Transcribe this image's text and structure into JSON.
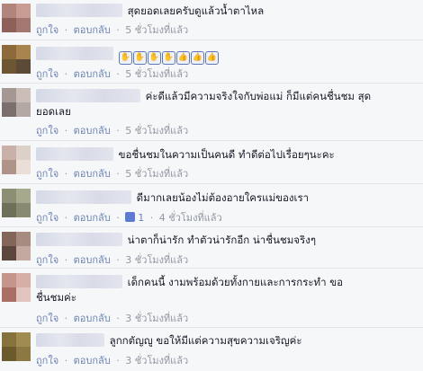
{
  "actions": {
    "like": "ถูกใจ",
    "reply": "ตอบกลับ",
    "sep": "·"
  },
  "comments": [
    {
      "text": [
        "สุดยอดเลยครับดูแล้วน้ำตาไหล"
      ],
      "time": "5 ชั่วโมงที่แล้ว"
    },
    {
      "text": [
        ""
      ],
      "time": "5 ชั่วโมงที่แล้ว",
      "icons": [
        "clapping-hands-icon",
        "thumbs-up-icon"
      ]
    },
    {
      "text": [
        "ค่ะดีแล้วมีความจริงใจกับพ่อแม่ ก็มีแต่คนชื่นชม สุด",
        "ยอดเลย"
      ],
      "time": "5 ชั่วโมงที่แล้ว"
    },
    {
      "text": [
        "ขอชื่นชมในความเป็นคนดี ทำดีต่อไปเรื่อยๆนะคะ"
      ],
      "time": "5 ชั่วโมงที่แล้ว"
    },
    {
      "text": [
        "ดีมากเลยน้องไม่ต้องอายใครแม่ของเรา"
      ],
      "time": "4 ชั่วโมงที่แล้ว",
      "likes": "1"
    },
    {
      "text": [
        "น่าตาก็น่ารัก ทำตัวน่ารักอีก น่าชื่นชมจริงๆ"
      ],
      "time": "3 ชั่วโมงที่แล้ว"
    },
    {
      "text": [
        "เด็กคนนี้ งามพร้อมด้วยทั้งกายและการกระทำ ขอ",
        "ชื่นชมค่ะ"
      ],
      "time": "3 ชั่วโมงที่แล้ว"
    },
    {
      "text": [
        "ลูกกตัญญู ขอให้มีแต่ความสุขความเจริญค่ะ"
      ],
      "time": "3 ชั่วโมงที่แล้ว"
    }
  ]
}
